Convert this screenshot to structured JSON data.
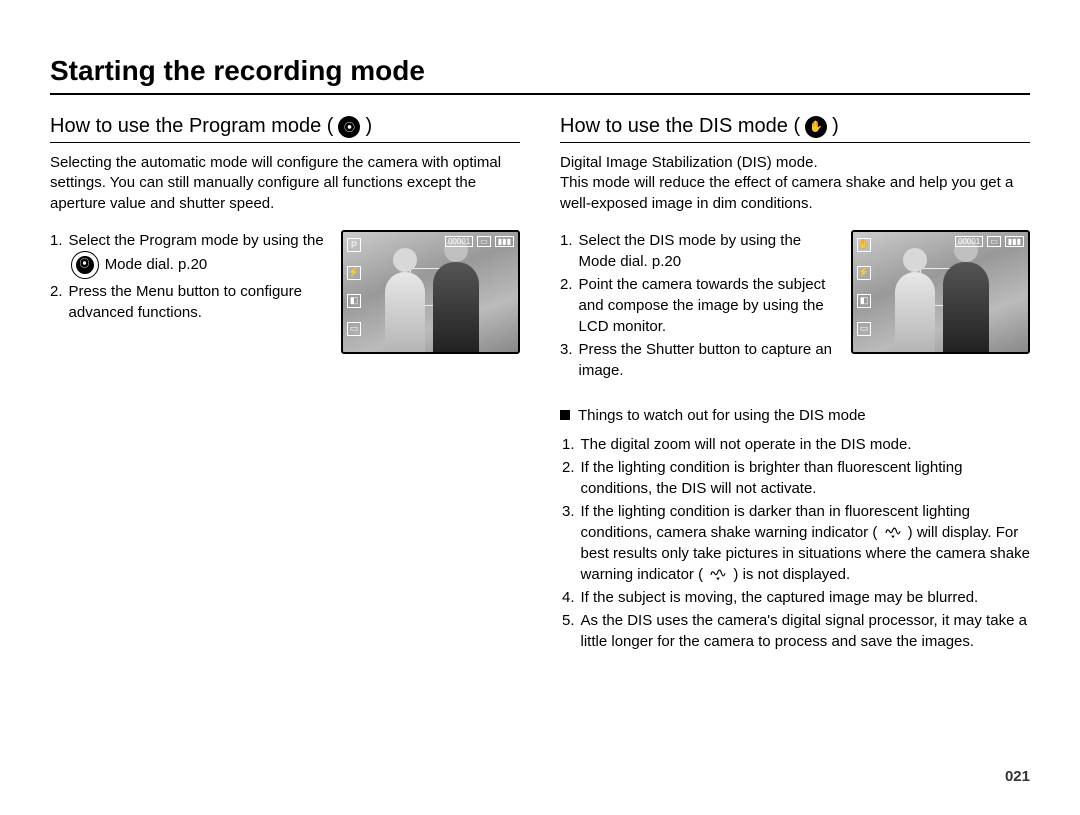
{
  "pageTitle": "Starting the recording mode",
  "pageNumber": "021",
  "left": {
    "heading_pre": "How to use the Program mode ( ",
    "heading_post": " )",
    "icon_label": "program-mode-icon",
    "icon_glyph": "⦿",
    "intro": "Selecting the automatic mode will configure the camera with optimal settings. You can still manually configure all functions except the aperture value and shutter speed.",
    "steps": [
      {
        "n": "1.",
        "text_pre": "Select the Program mode by using the ",
        "icon_label": "program-mode-icon",
        "icon_glyph": "⦿",
        "text_post": " Mode dial. p.20"
      },
      {
        "n": "2.",
        "text_pre": "Press the Menu button to configure advanced functions.",
        "icon_label": null,
        "icon_glyph": "",
        "text_post": ""
      }
    ]
  },
  "right": {
    "heading_pre": "How to use the DIS mode ( ",
    "heading_post": " )",
    "icon_label": "dis-mode-icon",
    "icon_glyph": "✋",
    "intro": "Digital Image Stabilization (DIS) mode.\nThis mode will reduce the effect of camera shake and help you get a well-exposed image in dim conditions.",
    "steps": [
      {
        "n": "1.",
        "text_pre": "Select the DIS mode by using the Mode dial. p.20",
        "icon_label": null,
        "icon_glyph": "",
        "text_post": ""
      },
      {
        "n": "2.",
        "text_pre": "Point the camera towards the subject and compose the image by using the LCD monitor.",
        "icon_label": null,
        "icon_glyph": "",
        "text_post": ""
      },
      {
        "n": "3.",
        "text_pre": "Press the Shutter button to capture an image.",
        "icon_label": null,
        "icon_glyph": "",
        "text_post": ""
      }
    ],
    "watchHeading": "Things to watch out for using the DIS mode",
    "watch": [
      {
        "n": "1.",
        "pre": "The digital zoom will not operate in the DIS mode.",
        "mid": "",
        "post": ""
      },
      {
        "n": "2.",
        "pre": "If the lighting condition is brighter than fluorescent lighting conditions, the DIS will not activate.",
        "mid": "",
        "post": ""
      },
      {
        "n": "3.",
        "pre": "If the lighting condition is darker than in fluorescent lighting conditions, camera shake warning indicator ( ",
        "mid": " ) will display. For best results only take pictures in situations where the camera shake warning indicator ( ",
        "post": " ) is not displayed."
      },
      {
        "n": "4.",
        "pre": "If the subject is moving, the captured image may be blurred.",
        "mid": "",
        "post": ""
      },
      {
        "n": "5.",
        "pre": "As the DIS uses the camera's digital signal processor, it may take a little longer for the camera to process and save the images.",
        "mid": "",
        "post": ""
      }
    ],
    "thumb_top_icon_glyph": "✋"
  }
}
